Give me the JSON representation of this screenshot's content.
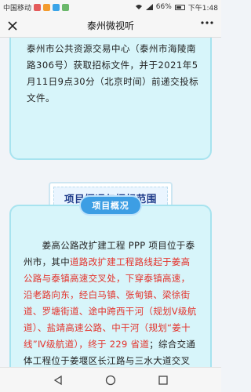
{
  "status_bar": {
    "carrier": "中国移动",
    "battery": "66%",
    "time": "下午1:48",
    "battery_level": 0.66
  },
  "header": {
    "title": "泰州微视听",
    "close_icon": "close-icon",
    "more_icon": "more-icon"
  },
  "card_top": {
    "text": "泰州市公共资源交易中心（泰州市海陵南路306号）获取招标文件，并于2021年5月11日9点30分（北京时间）前递交投标文件。"
  },
  "section": {
    "title": "项目概况与招标范围"
  },
  "overview": {
    "pill": "项目概况",
    "part1": "姜高公路改扩建工程 PPP 项目位于泰州市，其中",
    "part2": "道路改扩建工程路线起于姜高公路与泰镇高速交叉处，下穿泰镇高速，沿老路向东，经白马镇、张甸镇、梁徐街道、罗塘街道、途中跨西干河（规划Ⅴ级航道）、盐靖高速公路、中干河（规划“姜十线”Ⅳ级航道），终于 229 省道",
    "part3": "；综合交通体工程位于姜堰区长江路与三水大道交叉口西北角。"
  },
  "nav": {
    "back_icon": "back-triangle-icon",
    "home_icon": "home-circle-icon",
    "recents_icon": "recents-square-icon"
  }
}
